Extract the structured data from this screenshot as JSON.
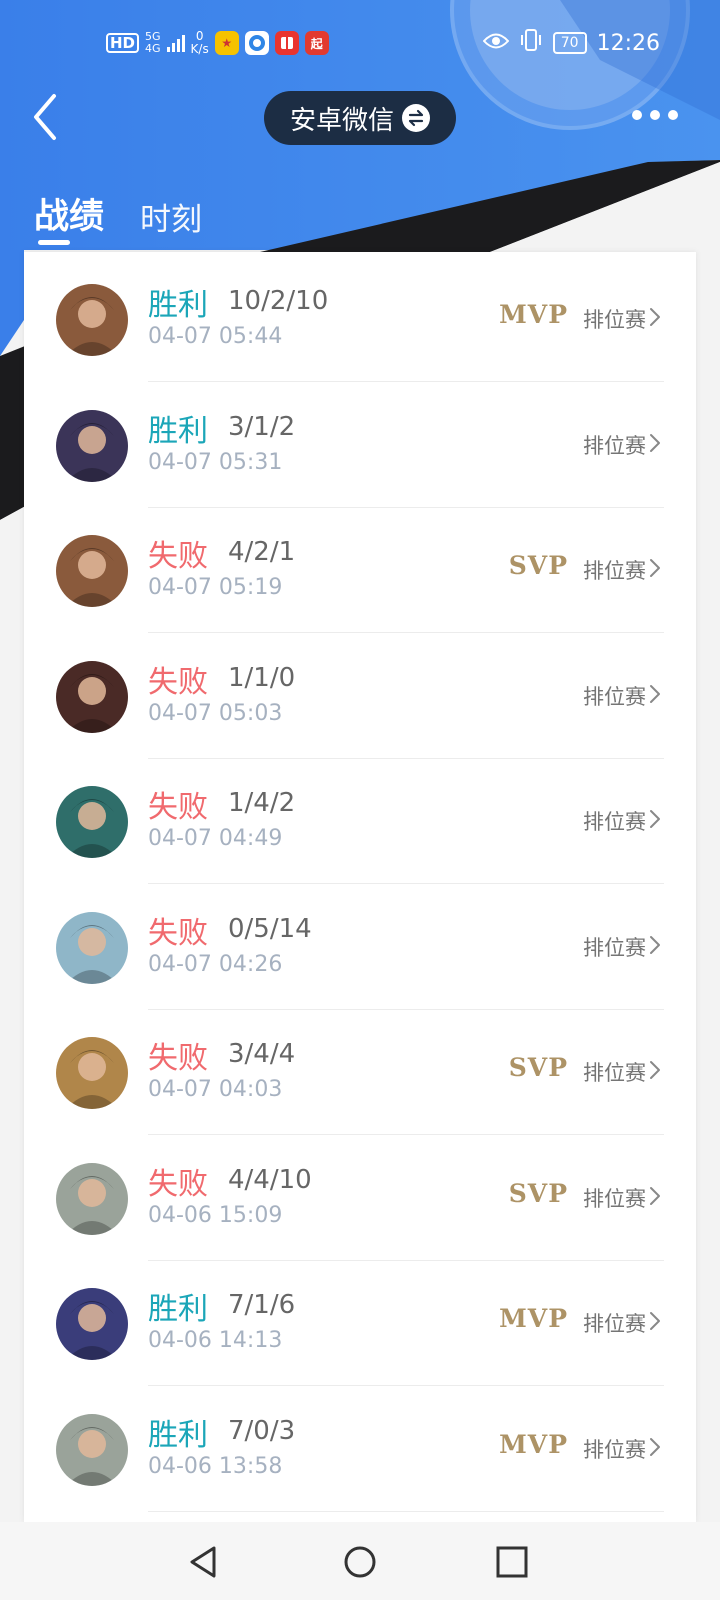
{
  "status_bar": {
    "hd": "HD",
    "signal_top": "5G",
    "signal_bottom": "4G",
    "speed_value": "0",
    "speed_unit": "K/s",
    "battery": "70",
    "time": "12:26",
    "app_icon_4_text": "起"
  },
  "nav": {
    "account_name": "安卓微信"
  },
  "tabs": [
    {
      "label": "战绩",
      "active": true
    },
    {
      "label": "时刻",
      "active": false
    }
  ],
  "matches": [
    {
      "result": "胜利",
      "outcome": "win",
      "kda": "10/2/10",
      "time": "04-07 05:44",
      "badge": "MVP",
      "type": "排位赛",
      "avatar": "hero-avatar-1",
      "avatar_color": "#8a5a3c"
    },
    {
      "result": "胜利",
      "outcome": "win",
      "kda": "3/1/2",
      "time": "04-07 05:31",
      "badge": "",
      "type": "排位赛",
      "avatar": "hero-avatar-2",
      "avatar_color": "#3b3458"
    },
    {
      "result": "失败",
      "outcome": "lose",
      "kda": "4/2/1",
      "time": "04-07 05:19",
      "badge": "SVP",
      "type": "排位赛",
      "avatar": "hero-avatar-3",
      "avatar_color": "#8a5a3c"
    },
    {
      "result": "失败",
      "outcome": "lose",
      "kda": "1/1/0",
      "time": "04-07 05:03",
      "badge": "",
      "type": "排位赛",
      "avatar": "hero-avatar-4",
      "avatar_color": "#4a2a26"
    },
    {
      "result": "失败",
      "outcome": "lose",
      "kda": "1/4/2",
      "time": "04-07 04:49",
      "badge": "",
      "type": "排位赛",
      "avatar": "hero-avatar-5",
      "avatar_color": "#2f6e6a"
    },
    {
      "result": "失败",
      "outcome": "lose",
      "kda": "0/5/14",
      "time": "04-07 04:26",
      "badge": "",
      "type": "排位赛",
      "avatar": "hero-avatar-6",
      "avatar_color": "#8fb6c8"
    },
    {
      "result": "失败",
      "outcome": "lose",
      "kda": "3/4/4",
      "time": "04-07 04:03",
      "badge": "SVP",
      "type": "排位赛",
      "avatar": "hero-avatar-7",
      "avatar_color": "#b0864a"
    },
    {
      "result": "失败",
      "outcome": "lose",
      "kda": "4/4/10",
      "time": "04-06 15:09",
      "badge": "SVP",
      "type": "排位赛",
      "avatar": "hero-avatar-8",
      "avatar_color": "#9aa39a"
    },
    {
      "result": "胜利",
      "outcome": "win",
      "kda": "7/1/6",
      "time": "04-06 14:13",
      "badge": "MVP",
      "type": "排位赛",
      "avatar": "hero-avatar-9",
      "avatar_color": "#3a3d7a"
    },
    {
      "result": "胜利",
      "outcome": "win",
      "kda": "7/0/3",
      "time": "04-06 13:58",
      "badge": "MVP",
      "type": "排位赛",
      "avatar": "hero-avatar-10",
      "avatar_color": "#9aa39a"
    }
  ],
  "colors": {
    "header_blue": "#3d86ea",
    "win": "#1ba6b8",
    "lose": "#f06a6e",
    "badge_gold": "#ad9366"
  }
}
